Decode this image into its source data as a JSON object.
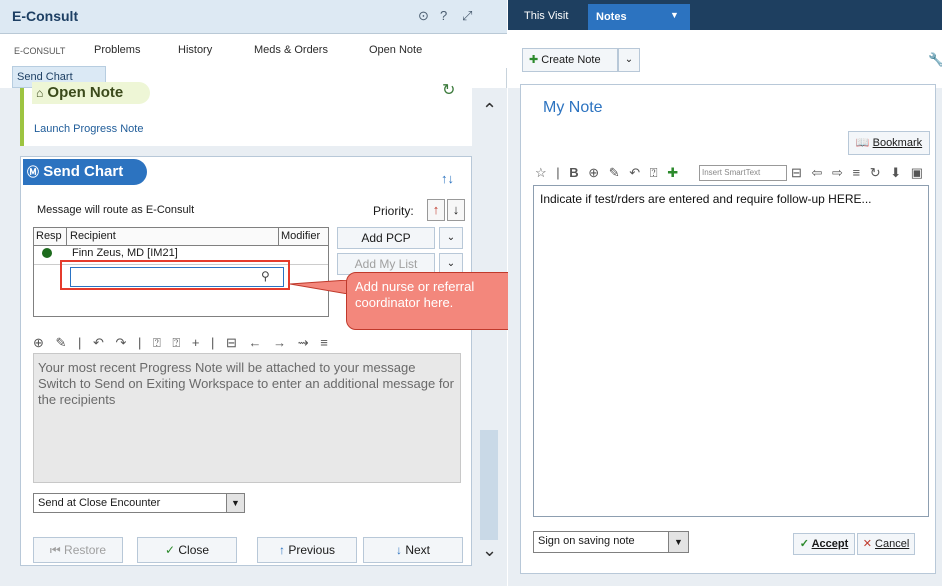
{
  "econsult": {
    "title": "E-Consult",
    "tabs": [
      "E-CONSULT",
      "Problems",
      "History",
      "Meds & Orders",
      "Open Note"
    ],
    "active_subtab": "Send Chart"
  },
  "open_note": {
    "title": "Open Note",
    "link": "Launch Progress Note"
  },
  "send_chart": {
    "title": "Send Chart",
    "route_text": "Message will route as E-Consult",
    "priority_label": "Priority:",
    "table_headers": [
      "Resp",
      "Recipient",
      "Modifier"
    ],
    "recipient": "Finn Zeus, MD [IM21]",
    "buttons": {
      "add_pcp": "Add PCP",
      "add_my_list": "Add My List"
    },
    "message": "Your most recent Progress Note will be attached to your message\nSwitch to Send on Exiting Workspace to enter an additional message for the recipients",
    "send_at": "Send at Close Encounter",
    "bottom_buttons": {
      "restore": "Restore",
      "close": "Close",
      "previous": "Previous",
      "next": "Next"
    }
  },
  "callout": {
    "text": "Add nurse or referral coordinator here."
  },
  "right": {
    "tabs": [
      "This Visit",
      "Notes"
    ],
    "create_note": "Create Note",
    "my_note": "My Note",
    "bookmark": "Bookmark",
    "insert_smarttext": "Insert SmartText",
    "note_text": "Indicate if test/rders are entered and require follow-up HERE...",
    "sign_option": "Sign on saving note",
    "accept": "Accept",
    "cancel": "Cancel"
  },
  "colors": {
    "accent": "#2c73c0",
    "header_dark": "#1e3f60",
    "callout": "#f3877c",
    "highlight_border": "#e53b2c"
  }
}
